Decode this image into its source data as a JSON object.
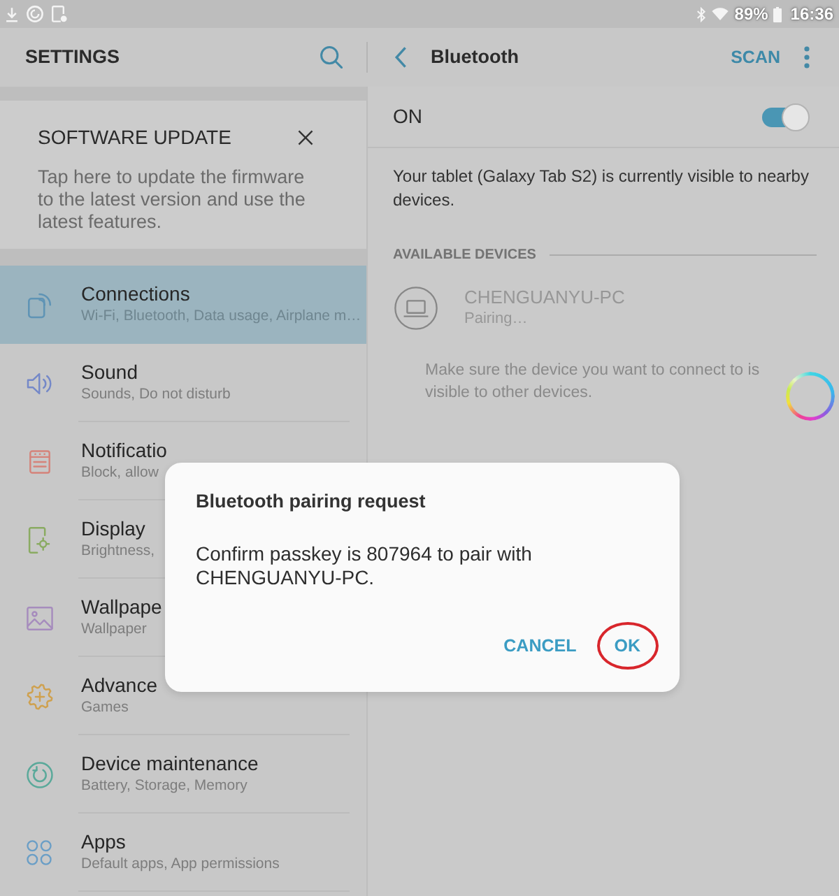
{
  "status_bar": {
    "battery": "89%",
    "time": "16:36"
  },
  "settings_header": {
    "title": "SETTINGS"
  },
  "software_update": {
    "title": "SOFTWARE UPDATE",
    "text": "Tap here to update the firmware to the latest version and use the latest features."
  },
  "menu": [
    {
      "title": "Connections",
      "subtitle": "Wi-Fi, Bluetooth, Data usage, Airplane m…",
      "selected": true
    },
    {
      "title": "Sound",
      "subtitle": "Sounds, Do not disturb",
      "selected": false
    },
    {
      "title": "Notificatio",
      "subtitle": "Block, allow",
      "selected": false
    },
    {
      "title": "Display",
      "subtitle": "Brightness,",
      "selected": false
    },
    {
      "title": "Wallpape",
      "subtitle": "Wallpaper",
      "selected": false
    },
    {
      "title": "Advance",
      "subtitle": "Games",
      "selected": false
    },
    {
      "title": "Device maintenance",
      "subtitle": "Battery, Storage, Memory",
      "selected": false
    },
    {
      "title": "Apps",
      "subtitle": "Default apps, App permissions",
      "selected": false
    }
  ],
  "bluetooth_header": {
    "title": "Bluetooth",
    "action": "SCAN"
  },
  "bluetooth": {
    "switch_label": "ON",
    "on": true,
    "visibility_text": "Your tablet (Galaxy Tab S2) is currently visible to nearby devices.",
    "section": "AVAILABLE DEVICES",
    "devices": [
      {
        "name": "CHENGUANYU-PC",
        "status": "Pairing…"
      }
    ],
    "hint": "Make sure the device you want to connect to is visible to other devices."
  },
  "dialog": {
    "title": "Bluetooth pairing request",
    "message": "Confirm passkey is 807964 to pair with CHENGUANYU-PC.",
    "buttons": [
      {
        "label": "CANCEL",
        "circled": false
      },
      {
        "label": "OK",
        "circled": true
      }
    ]
  }
}
